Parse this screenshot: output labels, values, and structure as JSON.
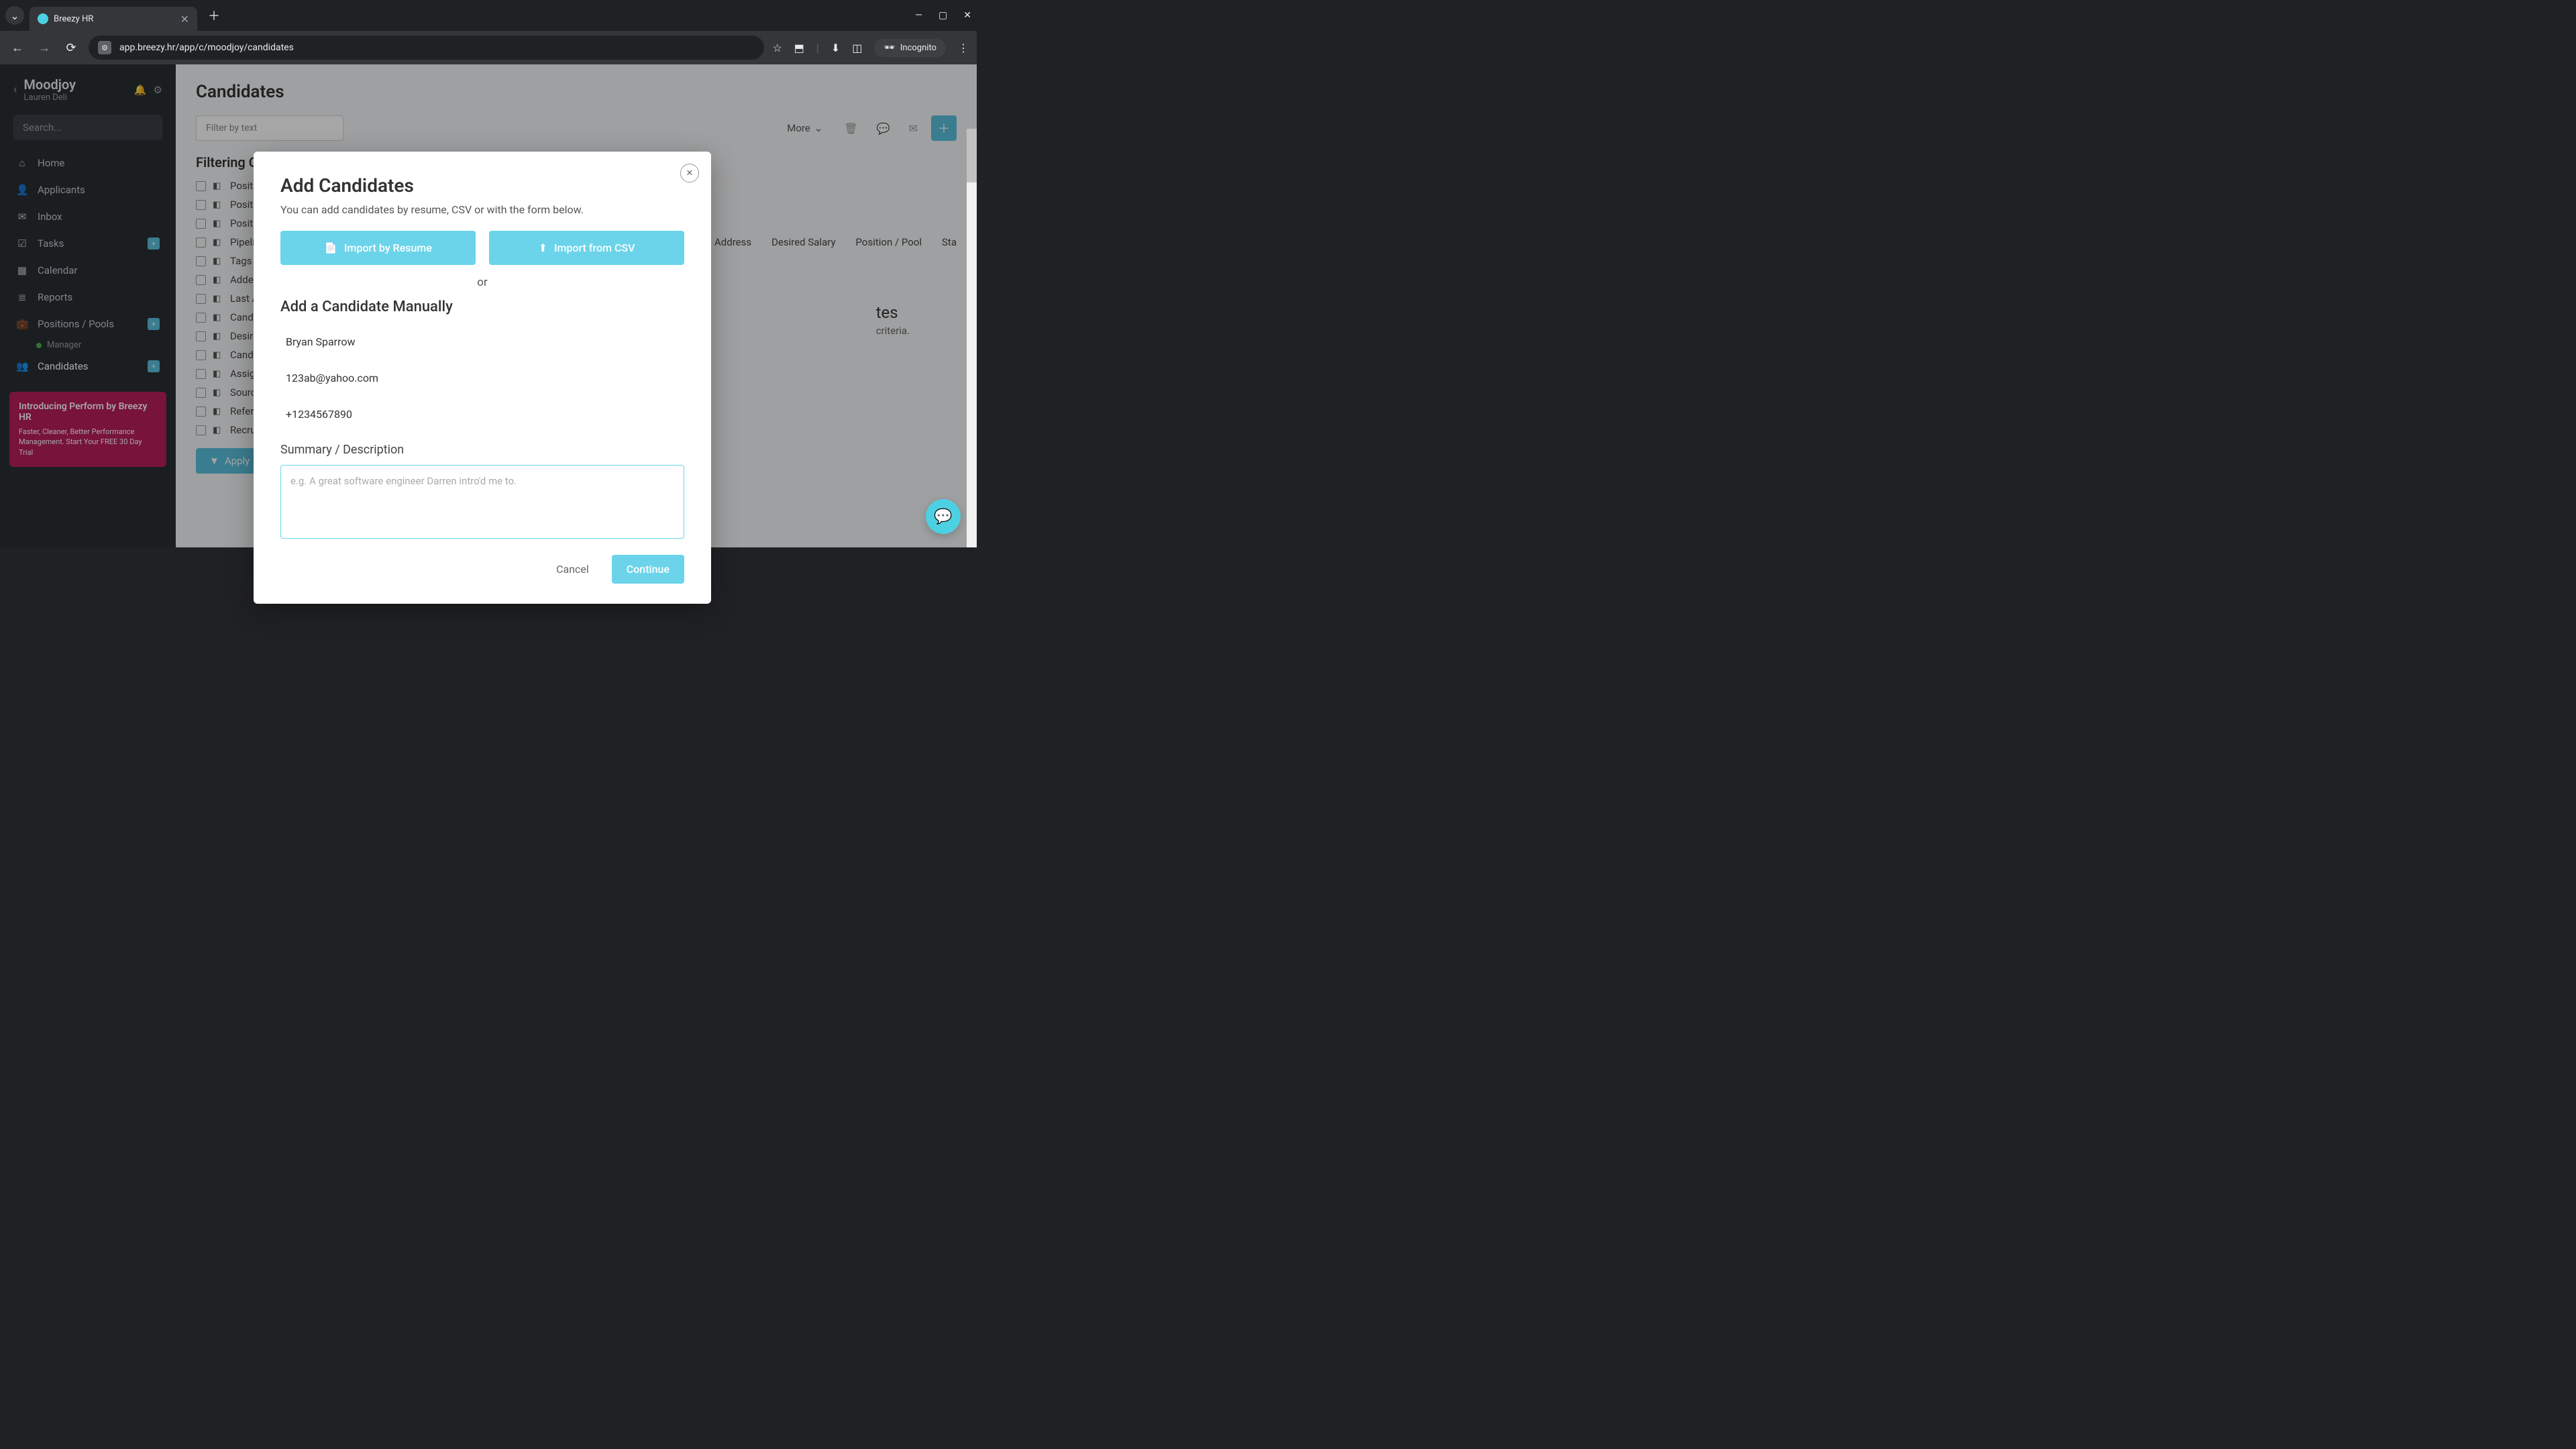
{
  "browser": {
    "tab_title": "Breezy HR",
    "url": "app.breezy.hr/app/c/moodjoy/candidates",
    "incognito_label": "Incognito"
  },
  "sidebar": {
    "org_name": "Moodjoy",
    "user_name": "Lauren Deli",
    "search_placeholder": "Search...",
    "items": [
      {
        "icon": "home",
        "label": "Home"
      },
      {
        "icon": "user",
        "label": "Applicants"
      },
      {
        "icon": "inbox",
        "label": "Inbox"
      },
      {
        "icon": "check",
        "label": "Tasks",
        "badge": "+"
      },
      {
        "icon": "calendar",
        "label": "Calendar"
      },
      {
        "icon": "report",
        "label": "Reports"
      },
      {
        "icon": "briefcase",
        "label": "Positions / Pools",
        "badge": "+"
      },
      {
        "icon": "users",
        "label": "Candidates",
        "badge": "+"
      }
    ],
    "sub_item": "Manager",
    "promo_title": "Introducing Perform by Breezy HR",
    "promo_text": "Faster, Cleaner, Better Performance Management. Start Your FREE 30 Day Trial"
  },
  "main": {
    "title": "Candidates",
    "filter_placeholder": "Filter by text",
    "more_label": "More",
    "section_title": "Filtering Criteria",
    "criteria": [
      "Position / Pool",
      "Position / Pool Status",
      "Position / Pool Location",
      "Pipeline Stage",
      "Tags",
      "Added Date",
      "Last Activity",
      "Candidate Location",
      "Desired Salary",
      "Candidate Status",
      "Assigned To",
      "Source",
      "Referred By",
      "Recruiter"
    ],
    "apply_label": "Apply",
    "table_headers": [
      "Address",
      "Desired Salary",
      "Position / Pool",
      "Sta"
    ],
    "empty_title_suffix": "tes",
    "empty_sub_suffix": "criteria."
  },
  "modal": {
    "title": "Add Candidates",
    "subtitle": "You can add candidates by resume, CSV or with the form below.",
    "import_resume": "Import by Resume",
    "import_csv": "Import from CSV",
    "or": "or",
    "manual_title": "Add a Candidate Manually",
    "name_value": "Bryan Sparrow",
    "email_value": "123ab@yahoo.com",
    "phone_value": "+1234567890",
    "summary_label": "Summary / Description",
    "summary_placeholder": "e.g. A great software engineer Darren intro'd me to.",
    "cancel": "Cancel",
    "continue": "Continue"
  },
  "icons": {
    "home": "⌂",
    "user": "👤",
    "inbox": "✉",
    "check": "☑",
    "calendar": "▦",
    "report": "≣",
    "briefcase": "💼",
    "users": "👥",
    "bell": "🔔",
    "gear": "⚙",
    "file": "📄",
    "upload": "⬆",
    "star": "☆",
    "puzzle": "⬒",
    "download": "⬇",
    "panel": "◫",
    "trash": "🗑",
    "chat": "💬",
    "mail": "✉",
    "incog": "🕶",
    "filter": "▼",
    "chevron_down": "⌄"
  }
}
